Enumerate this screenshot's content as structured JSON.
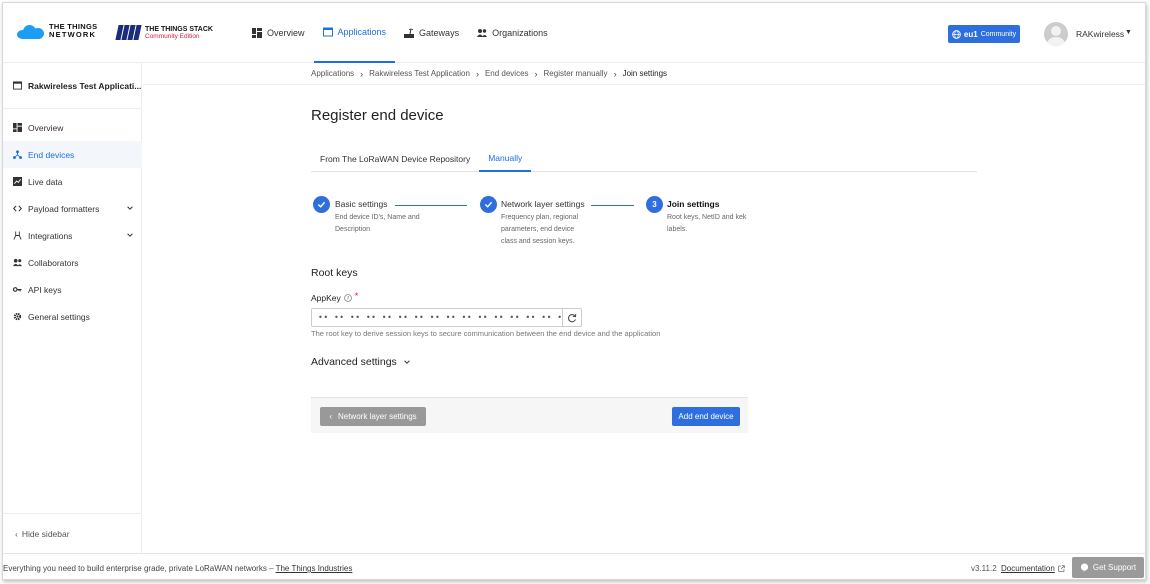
{
  "header": {
    "ttn_logo_line1": "THE THINGS",
    "ttn_logo_line2": "NETWORK",
    "tts_logo_line1": "THE THINGS STACK",
    "tts_logo_line2": "Community Edition",
    "nav": [
      {
        "label": "Overview",
        "icon": "grid-icon"
      },
      {
        "label": "Applications",
        "icon": "window-icon",
        "active": true
      },
      {
        "label": "Gateways",
        "icon": "gateway-icon"
      },
      {
        "label": "Organizations",
        "icon": "people-icon"
      }
    ],
    "region": {
      "code": "eu1",
      "label": "Community"
    },
    "username": "RAKwireless",
    "accent_color": "#2f6fdd"
  },
  "sidebar": {
    "app_name": "Rakwireless Test Applicati...",
    "items": [
      {
        "label": "Overview",
        "icon": "grid-icon"
      },
      {
        "label": "End devices",
        "icon": "devices-icon",
        "active": true
      },
      {
        "label": "Live data",
        "icon": "chart-icon"
      },
      {
        "label": "Payload formatters",
        "icon": "code-icon",
        "expandable": true
      },
      {
        "label": "Integrations",
        "icon": "integration-icon",
        "expandable": true
      },
      {
        "label": "Collaborators",
        "icon": "people-icon"
      },
      {
        "label": "API keys",
        "icon": "key-icon"
      },
      {
        "label": "General settings",
        "icon": "gear-icon"
      }
    ],
    "hide_label": "Hide sidebar"
  },
  "breadcrumb": [
    "Applications",
    "Rakwireless Test Application",
    "End devices",
    "Register manually",
    "Join settings"
  ],
  "main": {
    "title": "Register end device",
    "tabs": [
      {
        "label": "From The LoRaWAN Device Repository"
      },
      {
        "label": "Manually",
        "active": true
      }
    ],
    "steps": [
      {
        "title": "Basic settings",
        "desc_lines": [
          "End device ID's, Name and",
          "Description"
        ],
        "done": true
      },
      {
        "title": "Network layer settings",
        "desc_lines": [
          "Frequency plan, regional",
          "parameters, end device",
          "class and session keys."
        ],
        "done": true
      },
      {
        "number": "3",
        "title": "Join settings",
        "desc_lines": [
          "Root keys, NetID and kek",
          "labels."
        ],
        "done": false
      }
    ],
    "root_keys_title": "Root keys",
    "appkey": {
      "label": "AppKey",
      "value": "•• •• •• •• •• •• •• •• •• •• •• •• •• •• •• ••",
      "description": "The root key to derive session keys to secure communication between the end device and the application"
    },
    "advanced_label": "Advanced settings",
    "back_button": "Network layer settings",
    "submit_button": "Add end device"
  },
  "footer": {
    "text": "Everything you need to build enterprise grade, private LoRaWAN networks – ",
    "link": "The Things Industries",
    "version": "v3.11.2",
    "docs": "Documentation",
    "support": "Get Support"
  }
}
